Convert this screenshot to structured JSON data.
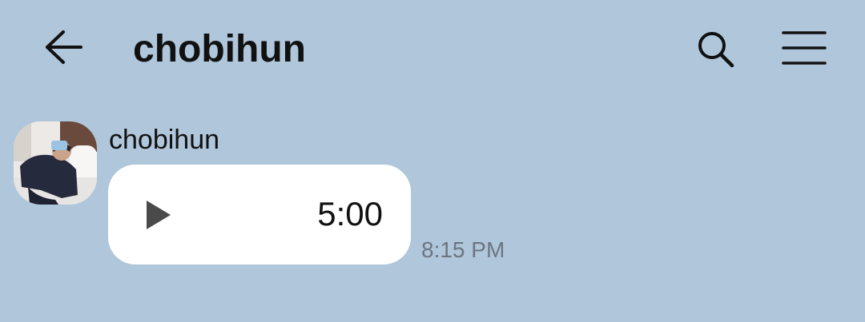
{
  "header": {
    "title": "chobihun",
    "back_icon": "arrow-left-icon",
    "search_icon": "search-icon",
    "menu_icon": "hamburger-menu-icon"
  },
  "message": {
    "sender": "chobihun",
    "avatar_icon": "profile-photo",
    "voice": {
      "play_icon": "play-icon",
      "duration": "5:00"
    },
    "time": "8:15 PM"
  },
  "colors": {
    "background": "#b0c6db",
    "bubble": "#ffffff",
    "timestamp": "#6c7682",
    "play_icon": "#4a4a4a"
  }
}
